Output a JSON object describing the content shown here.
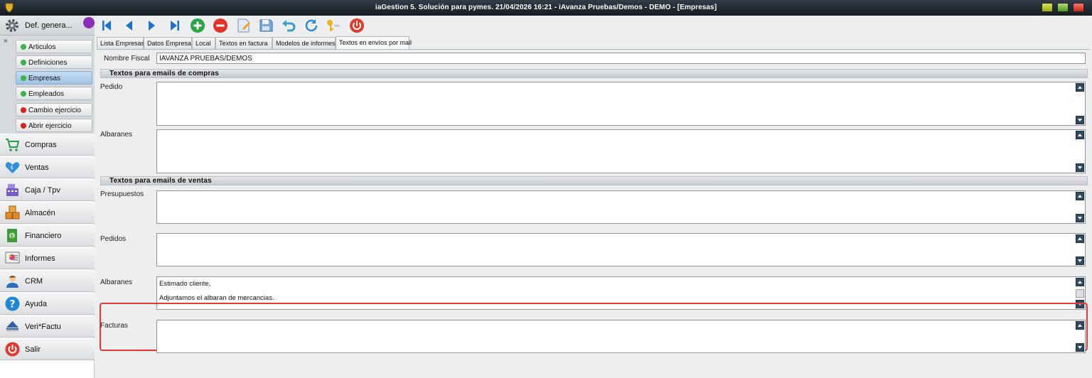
{
  "window": {
    "title": "iaGestion 5. Solución para pymes.  21/04/2026 16:21  -  iAvanza Pruebas/Demos - DEMO - [Empresas]"
  },
  "sidebar": {
    "header_label": "Def. genera...",
    "sub_items": [
      {
        "label": "Articulos",
        "status": "green"
      },
      {
        "label": "Definiciones",
        "status": "green"
      },
      {
        "label": "Empresas",
        "status": "green",
        "selected": true
      },
      {
        "label": "Empleados",
        "status": "green"
      },
      {
        "label": "Cambio ejercicio",
        "status": "red"
      },
      {
        "label": "Abrir ejercicio",
        "status": "red"
      }
    ],
    "modules": [
      {
        "label": "Compras",
        "icon": "cart-icon"
      },
      {
        "label": "Ventas",
        "icon": "heart-sales-icon"
      },
      {
        "label": "Caja / Tpv",
        "icon": "cash-register-icon"
      },
      {
        "label": "Almacén",
        "icon": "warehouse-boxes-icon"
      },
      {
        "label": "Financiero",
        "icon": "money-icon"
      },
      {
        "label": "Informes",
        "icon": "report-chart-icon"
      },
      {
        "label": "CRM",
        "icon": "person-icon"
      },
      {
        "label": "Ayuda",
        "icon": "help-icon"
      },
      {
        "label": "Veri*Factu",
        "icon": "verifactu-logo-icon"
      },
      {
        "label": "Salir",
        "icon": "power-icon"
      }
    ]
  },
  "toolbar": {
    "buttons": [
      "first-record-icon",
      "previous-record-icon",
      "next-record-icon",
      "last-record-icon",
      "add-icon",
      "delete-icon",
      "edit-icon",
      "save-icon",
      "undo-icon",
      "refresh-icon",
      "keys-icon",
      "exit-icon"
    ]
  },
  "tabs": [
    {
      "label": "Lista Empresas"
    },
    {
      "label": "Datos Empresa"
    },
    {
      "label": "Local"
    },
    {
      "label": "Textos en factura"
    },
    {
      "label": "Modelos de informes"
    },
    {
      "label": "Textos en envíos por mail",
      "active": true
    }
  ],
  "form": {
    "nombre_fiscal_label": "Nombre Fiscal",
    "nombre_fiscal_value": "IAVANZA PRUEBAS/DEMOS",
    "compras": {
      "section_title": "Textos para emails de compras",
      "pedido_label": "Pedido",
      "pedido_value": "",
      "albaranes_label": "Albaranes",
      "albaranes_value": ""
    },
    "ventas": {
      "section_title": "Textos para emails de ventas",
      "presupuestos_label": "Presupuestos",
      "presupuestos_value": "",
      "pedidos_label": "Pedidos",
      "pedidos_value": "",
      "albaranes_label": "Albaranes",
      "albaranes_line1": "Estimado cliente,",
      "albaranes_line2": "Adjuntamos el albaran de mercancias.",
      "facturas_label": "Facturas",
      "facturas_value": ""
    }
  },
  "colors": {
    "highlight": "#e53935",
    "selected_item": "#9ec3e5",
    "status_green": "#39b54a",
    "status_red": "#e0201a",
    "titlebar": "#1e262e"
  }
}
